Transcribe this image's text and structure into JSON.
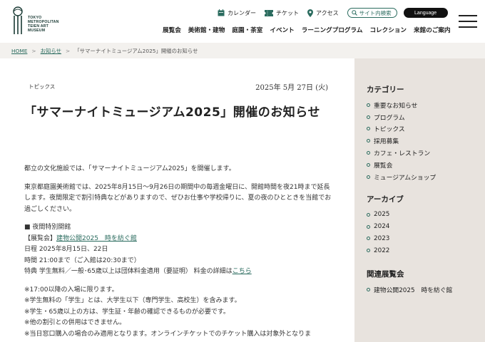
{
  "header": {
    "logo_lines": [
      "TOKYO",
      "METROPOLITAN",
      "TEIEN ART",
      "MUSEUM"
    ],
    "util": {
      "calendar": "カレンダー",
      "ticket": "チケット",
      "access": "アクセス",
      "site_search": "サイト内検索",
      "language": "Language"
    },
    "nav": [
      "展覧会",
      "美術館・建物",
      "庭園・茶室",
      "イベント",
      "ラーニングプログラム",
      "コレクション",
      "来館のご案内"
    ]
  },
  "breadcrumb": {
    "home": "HOME",
    "notices": "お知らせ",
    "current": "「サマーナイトミュージアム2025」開催のお知らせ",
    "separator": ">"
  },
  "article": {
    "category": "トピックス",
    "date": "2025年 5月 27日 (火)",
    "title": "「サマーナイトミュージアム2025」開催のお知らせ",
    "intro": "都立の文化施設では、「サマーナイトミュージアム2025」を開催します。",
    "para2": "東京都庭園美術館では、2025年8月15日～9月26日の期間中の毎週金曜日に、開館時間を夜21時まで延長します。夜間限定で割引特典などがありますので、ぜひお仕事や学校帰りに、夏の夜のひとときを当館でお過ごしください。",
    "section_head": "■ 夜間特別開館",
    "exhibition_prefix": "【展覧会】",
    "exhibition_link": "建物公開2025　時を紡ぐ館",
    "schedule": "日程 2025年8月15日、22日",
    "hours": "時間 21:00まで（ご入館は20:30まで）",
    "benefit_text": "特典 学生無料／一般･65歳以上は団体料金適用（要証明） 料金の詳細は",
    "benefit_link": "こちら",
    "notes": [
      "※17:00以降の入場に限ります。",
      "※学生無料の「学生」とは、大学生以下（専門学生、高校生）を含みます。",
      "※学生・65歳以上の方は、学生証・年齢の確認できるものが必要です。",
      "※他の割引との併用はできません。",
      "※当日窓口購入の場合のみ適用となります。オンラインチケットでのチケット購入は対象外となりま"
    ]
  },
  "sidebar": {
    "categories_title": "カテゴリー",
    "categories": [
      "重要なお知らせ",
      "プログラム",
      "トピックス",
      "採用募集",
      "カフェ・レストラン",
      "展覧会",
      "ミュージアムショップ"
    ],
    "archive_title": "アーカイブ",
    "archive": [
      "2025",
      "2024",
      "2023",
      "2022"
    ],
    "related_title": "関連展覧会",
    "related": [
      "建物公開2025　時を紡ぐ館"
    ]
  },
  "colors": {
    "accent": "#2a6b5e",
    "sidebar_bg": "#e8e3de",
    "breadcrumb_bg": "#f3f1ee"
  }
}
